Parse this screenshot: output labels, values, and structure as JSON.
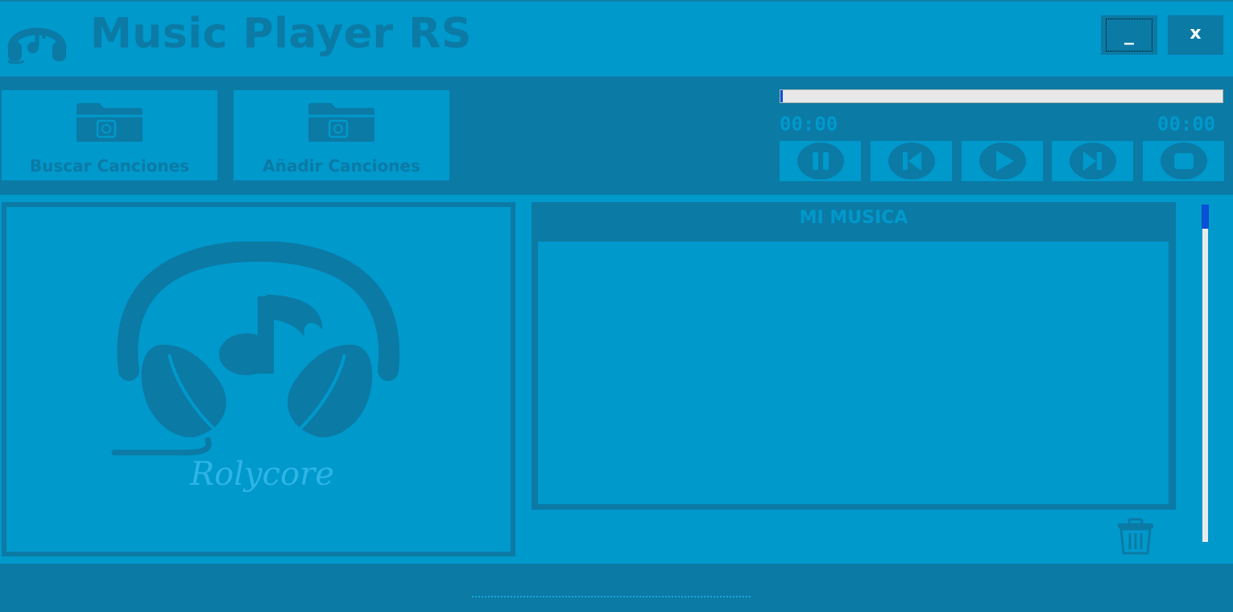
{
  "app": {
    "title": "Music Player RS",
    "logo_icon": "headphones-music-icon"
  },
  "window_controls": {
    "minimize_label": "_",
    "close_label": "x"
  },
  "toolbar": {
    "buscar_label": "Buscar Canciones",
    "anadir_label": "Añadir Canciones",
    "folder_icon": "music-folder-icon"
  },
  "player": {
    "progress_fraction": 0.0,
    "time_elapsed": "00:00",
    "time_total": "00:00",
    "controls": [
      {
        "name": "pause",
        "icon": "pause-icon"
      },
      {
        "name": "previous",
        "icon": "skip-previous-icon"
      },
      {
        "name": "play",
        "icon": "play-icon"
      },
      {
        "name": "next",
        "icon": "skip-next-icon"
      },
      {
        "name": "stop",
        "icon": "stop-icon"
      }
    ]
  },
  "album_art": {
    "icon": "headphones-music-note-icon",
    "caption": "Rolycore"
  },
  "playlist": {
    "header": "MI MUSICA",
    "items": [],
    "delete_icon": "trash-icon"
  },
  "colors": {
    "background": "#0099cc",
    "dark_panel": "#0b7aa5",
    "accent": "#0a4fd6",
    "caption": "#2fb4e6"
  }
}
